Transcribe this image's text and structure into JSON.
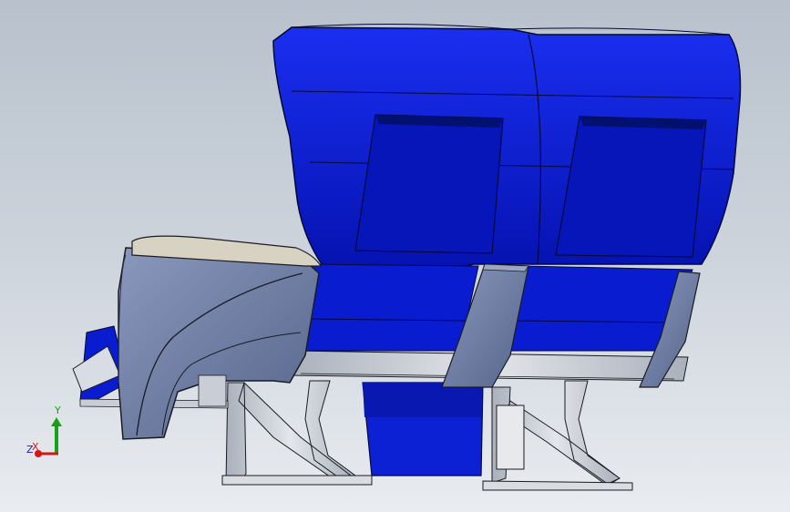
{
  "scene": {
    "subject": "cad-model-aircraft-seat-row",
    "colors": {
      "background_top": "#b8c1cc",
      "background_bottom": "#e9ecf0",
      "seat_blue": "#0a1fd6",
      "seat_blue_dark": "#04108a",
      "panel_slate": "#6f7fa3",
      "frame_grey": "#c9ced6",
      "armrest_pad": "#d8d2c2",
      "outline": "#1b1b22"
    }
  },
  "triad": {
    "x_label": "X",
    "y_label": "Y",
    "z_label": "Z",
    "x_color": "#d01818",
    "y_color": "#18a018",
    "z_color": "#1818d0"
  }
}
